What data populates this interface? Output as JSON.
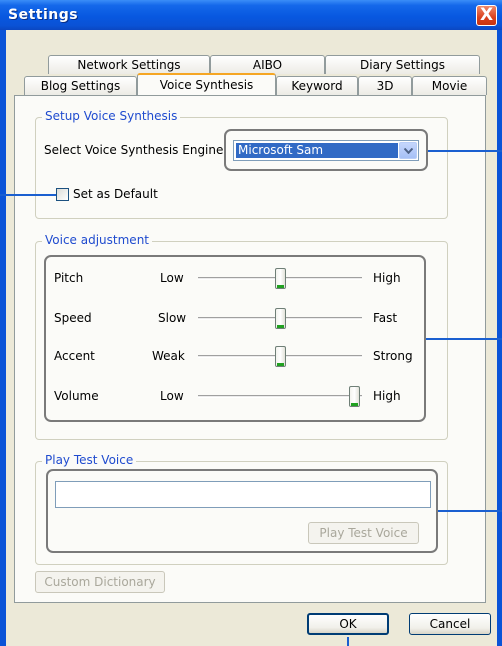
{
  "window": {
    "title": "Settings",
    "close_glyph": "X"
  },
  "tabs": {
    "row_back": [
      "Network Settings",
      "AIBO",
      "Diary Settings"
    ],
    "row_front": [
      "Blog Settings",
      "Voice Synthesis",
      "Keyword",
      "3D",
      "Movie"
    ],
    "active": "Voice Synthesis"
  },
  "setup": {
    "legend": "Setup Voice Synthesis",
    "engine_label": "Select Voice Synthesis Engine",
    "engine_value": "Microsoft Sam",
    "default_label": "Set as Default",
    "default_checked": false
  },
  "adjust": {
    "legend": "Voice adjustment",
    "sliders": [
      {
        "name": "Pitch",
        "low": "Low",
        "high": "High",
        "level": 0.5
      },
      {
        "name": "Speed",
        "low": "Slow",
        "high": "Fast",
        "level": 0.5
      },
      {
        "name": "Accent",
        "low": "Weak",
        "high": "Strong",
        "level": 0.5
      },
      {
        "name": "Volume",
        "low": "Low",
        "high": "High",
        "level": 1.0
      }
    ]
  },
  "test": {
    "legend": "Play Test Voice",
    "text_value": "",
    "play_button": "Play Test Voice"
  },
  "custom_dictionary_button": "Custom Dictionary",
  "footer": {
    "ok": "OK",
    "cancel": "Cancel"
  },
  "colors": {
    "title_bar": "#0858e0",
    "callout_border": "#7a7a7a",
    "leader_line": "#1a5fd0"
  },
  "icons": {
    "close": "close-icon",
    "dropdown": "chevron-down-icon"
  }
}
